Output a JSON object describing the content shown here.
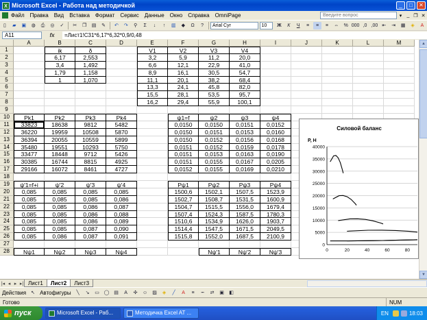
{
  "window": {
    "title": "Microsoft Excel - Работа над методичкой"
  },
  "menu": {
    "items": [
      "Файл",
      "Правка",
      "Вид",
      "Вставка",
      "Формат",
      "Сервис",
      "Данные",
      "Окно",
      "Справка",
      "OmniPage"
    ],
    "help_placeholder": "Введите вопрос"
  },
  "toolbar": {
    "font_name": "Arial Cyr",
    "font_size": "10"
  },
  "formula_bar": {
    "name_box": "A11",
    "fx": "fx",
    "formula": "=Лист1!C31*6,17*6,32*0,9/0,48"
  },
  "columns": [
    "A",
    "B",
    "C",
    "D",
    "E",
    "F",
    "G",
    "H",
    "I",
    "J",
    "K",
    "L",
    "M"
  ],
  "rows": [
    {
      "n": "1",
      "c": [
        "",
        "ik",
        "δ",
        "",
        "V1",
        "V2",
        "V3",
        "V4",
        "",
        "",
        "",
        "",
        ""
      ]
    },
    {
      "n": "2",
      "c": [
        "",
        "6,17",
        "2,553",
        "",
        "3,2",
        "5,9",
        "11,2",
        "20,0",
        "",
        "",
        "",
        "",
        ""
      ]
    },
    {
      "n": "3",
      "c": [
        "",
        "3,4",
        "1,492",
        "",
        "6,6",
        "12,1",
        "22,9",
        "41,0",
        "",
        "",
        "",
        "",
        ""
      ]
    },
    {
      "n": "4",
      "c": [
        "",
        "1,79",
        "1,158",
        "",
        "8,9",
        "16,1",
        "30,5",
        "54,7",
        "",
        "",
        "",
        "",
        ""
      ]
    },
    {
      "n": "5",
      "c": [
        "",
        "1",
        "1,070",
        "",
        "11,1",
        "20,1",
        "38,2",
        "68,4",
        "",
        "",
        "",
        "",
        ""
      ]
    },
    {
      "n": "6",
      "c": [
        "",
        "",
        "",
        "",
        "13,3",
        "24,1",
        "45,8",
        "82,0",
        "",
        "",
        "",
        "",
        ""
      ]
    },
    {
      "n": "7",
      "c": [
        "",
        "",
        "",
        "",
        "15,5",
        "28,1",
        "53,5",
        "95,7",
        "",
        "",
        "",
        "",
        ""
      ]
    },
    {
      "n": "8",
      "c": [
        "",
        "",
        "",
        "",
        "16,2",
        "29,4",
        "55,9",
        "100,1",
        "",
        "",
        "",
        "",
        ""
      ]
    },
    {
      "n": "9",
      "c": [
        "",
        "",
        "",
        "",
        "",
        "",
        "",
        "",
        "",
        "",
        "",
        "",
        ""
      ]
    },
    {
      "n": "10",
      "c": [
        "Pk1",
        "Pk2",
        "Pk3",
        "Pk4",
        "",
        "ψ1=f",
        "ψ2",
        "ψ3",
        "ψ4",
        "",
        "",
        "",
        ""
      ]
    },
    {
      "n": "11",
      "c": [
        "33823",
        "18638",
        "9812",
        "5482",
        "",
        "0,0150",
        "0,0150",
        "0,0151",
        "0,0152",
        "",
        "",
        "",
        ""
      ]
    },
    {
      "n": "12",
      "c": [
        "36220",
        "19959",
        "10508",
        "5870",
        "",
        "0,0150",
        "0,0151",
        "0,0153",
        "0,0160",
        "",
        "",
        "",
        ""
      ]
    },
    {
      "n": "13",
      "c": [
        "36394",
        "20055",
        "10559",
        "5899",
        "",
        "0,0150",
        "0,0152",
        "0,0156",
        "0,0168",
        "",
        "",
        "",
        ""
      ]
    },
    {
      "n": "14",
      "c": [
        "35480",
        "19551",
        "10293",
        "5750",
        "",
        "0,0151",
        "0,0152",
        "0,0159",
        "0,0178",
        "",
        "",
        "",
        ""
      ]
    },
    {
      "n": "15",
      "c": [
        "33477",
        "18448",
        "9712",
        "5426",
        "",
        "0,0151",
        "0,0153",
        "0,0163",
        "0,0190",
        "",
        "",
        "",
        ""
      ]
    },
    {
      "n": "16",
      "c": [
        "30385",
        "16744",
        "8815",
        "4925",
        "",
        "0,0151",
        "0,0155",
        "0,0167",
        "0,0205",
        "",
        "",
        "",
        ""
      ]
    },
    {
      "n": "17",
      "c": [
        "29166",
        "16072",
        "8461",
        "4727",
        "",
        "0,0152",
        "0,0155",
        "0,0169",
        "0,0210",
        "",
        "",
        "",
        ""
      ]
    },
    {
      "n": "18",
      "c": [
        "",
        "",
        "",
        "",
        "",
        "",
        "",
        "",
        "",
        "",
        "",
        "",
        ""
      ]
    },
    {
      "n": "19",
      "c": [
        "ψ'1=f+i",
        "ψ'2",
        "ψ'3",
        "ψ'4",
        "",
        "Pψ1",
        "Pψ2",
        "Pψ3",
        "Pψ4",
        "",
        "",
        "",
        ""
      ]
    },
    {
      "n": "20",
      "c": [
        "0,085",
        "0,085",
        "0,085",
        "0,085",
        "",
        "1500,6",
        "1502,1",
        "1507,5",
        "1523,9",
        "",
        "",
        "",
        ""
      ]
    },
    {
      "n": "21",
      "c": [
        "0,085",
        "0,085",
        "0,085",
        "0,086",
        "",
        "1502,7",
        "1508,7",
        "1531,5",
        "1600,9",
        "",
        "",
        "",
        ""
      ]
    },
    {
      "n": "22",
      "c": [
        "0,085",
        "0,085",
        "0,086",
        "0,087",
        "",
        "1504,7",
        "1515,5",
        "1556,0",
        "1679,4",
        "",
        "",
        "",
        ""
      ]
    },
    {
      "n": "23",
      "c": [
        "0,085",
        "0,085",
        "0,086",
        "0,088",
        "",
        "1507,4",
        "1524,3",
        "1587,5",
        "1780,3",
        "",
        "",
        "",
        ""
      ]
    },
    {
      "n": "24",
      "c": [
        "0,085",
        "0,085",
        "0,086",
        "0,089",
        "",
        "1510,6",
        "1534,9",
        "1626,0",
        "1903,7",
        "",
        "",
        "",
        ""
      ]
    },
    {
      "n": "25",
      "c": [
        "0,085",
        "0,085",
        "0,087",
        "0,090",
        "",
        "1514,4",
        "1547,5",
        "1671,5",
        "2049,5",
        "",
        "",
        "",
        ""
      ]
    },
    {
      "n": "26",
      "c": [
        "0,085",
        "0,086",
        "0,087",
        "0,091",
        "",
        "1515,8",
        "1552,0",
        "1687,5",
        "2100,9",
        "",
        "",
        "",
        ""
      ]
    },
    {
      "n": "27",
      "c": [
        "",
        "",
        "",
        "",
        "",
        "",
        "",
        "",
        "",
        "",
        "",
        "",
        ""
      ]
    },
    {
      "n": "28",
      "c": [
        "Nψ1",
        "Nψ2",
        "Nψ3",
        "Nψ4",
        "",
        "",
        "Nψ'1",
        "Nψ'2",
        "Nψ'3",
        "",
        "",
        "",
        ""
      ]
    }
  ],
  "chart_data": {
    "type": "line",
    "title": "Силовой баланс",
    "ylabel": "P, Н",
    "xlabel": "",
    "ylim": [
      0,
      40000
    ],
    "xlim": [
      0,
      90
    ],
    "yticks": [
      "40000",
      "35000",
      "30000",
      "25000",
      "20000",
      "15000",
      "10000",
      "5000",
      "0"
    ],
    "xticks": [
      "0",
      "20",
      "40",
      "60",
      "80"
    ],
    "grid": true,
    "series": [
      {
        "x": [
          3.2,
          6.6,
          8.9,
          11.1,
          13.3,
          15.5,
          16.2
        ],
        "values": [
          33823,
          36220,
          36394,
          35480,
          33477,
          30385,
          29166
        ]
      },
      {
        "x": [
          5.9,
          12.1,
          16.1,
          20.1,
          24.1,
          28.1,
          29.4
        ],
        "values": [
          18638,
          19959,
          20055,
          19551,
          18448,
          16744,
          16072
        ]
      },
      {
        "x": [
          11.2,
          22.9,
          30.5,
          38.2,
          45.8,
          53.5,
          55.9
        ],
        "values": [
          9812,
          10508,
          10559,
          10293,
          9712,
          8815,
          8461
        ]
      },
      {
        "x": [
          20.0,
          41.0,
          54.7,
          68.4,
          82.0,
          95.7,
          100.1
        ],
        "values": [
          5482,
          5870,
          5899,
          5750,
          5426,
          4925,
          4727
        ]
      },
      {
        "x": [
          3.2,
          8.9,
          13.3,
          16.2,
          30.5,
          45.8,
          55.9,
          68.4,
          95.7
        ],
        "values": [
          1500.6,
          1504.7,
          1510.6,
          1515.8,
          1556.0,
          1626.0,
          1687.5,
          1780.3,
          2049.5
        ]
      },
      {
        "x": [
          20.0,
          41.0,
          54.7,
          68.4,
          82.0,
          95.7,
          100.1
        ],
        "values": [
          1523.9,
          1600.9,
          1679.4,
          1780.3,
          1903.7,
          2049.5,
          2100.9
        ]
      }
    ]
  },
  "sheet_tabs": [
    "Лист1",
    "Лист2",
    "Лист3"
  ],
  "active_sheet": "Лист2",
  "draw_toolbar": {
    "actions": "Действия",
    "autoshapes": "Автофигуры"
  },
  "status": {
    "text": "Готово",
    "num": "NUM"
  },
  "taskbar": {
    "start": "пуск",
    "buttons": [
      "Microsoft Excel - Раб...",
      "Методичка Excel AT ..."
    ],
    "lang": "EN",
    "clock": "18:03"
  }
}
